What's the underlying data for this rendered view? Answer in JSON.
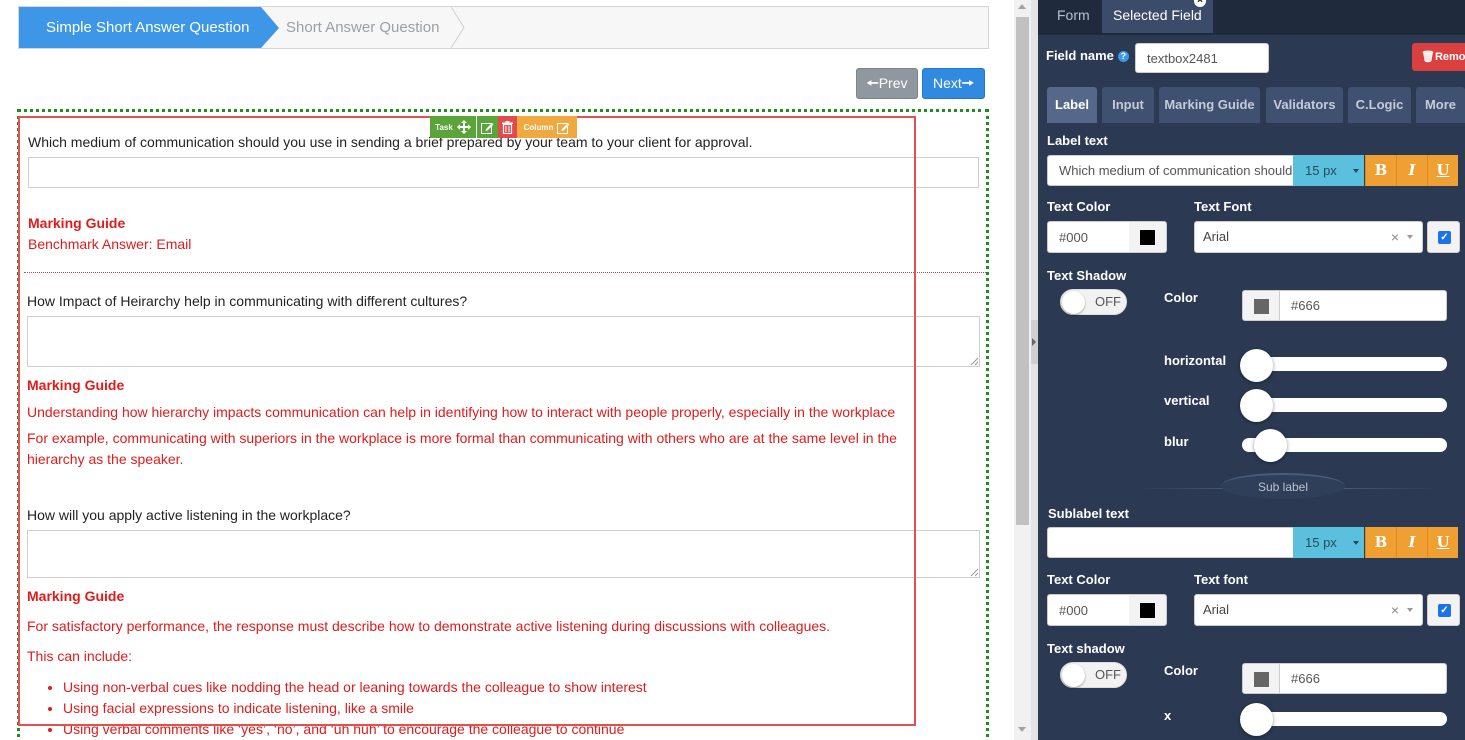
{
  "wizard": {
    "step1": "Simple Short Answer Question",
    "step2": "Short Answer Question"
  },
  "nav": {
    "prev": "Prev",
    "next": "Next"
  },
  "toolbar": {
    "task": "Task",
    "column": "Column"
  },
  "questions": [
    {
      "text": "Which medium of communication should you use in sending a brief prepared by your team to your client for approval.",
      "marking_title": "Marking Guide",
      "marking_lines": [
        "Benchmark Answer: Email"
      ]
    },
    {
      "text": "How Impact of Heirarchy help in communicating with different cultures?",
      "marking_title": "Marking Guide",
      "marking_lines": [
        "Understanding how hierarchy impacts communication can help in identifying how to interact with people properly, especially in the workplace",
        "For example, communicating with superiors in the workplace is more formal than communicating with others who are at the same level in the hierarchy as the speaker."
      ]
    },
    {
      "text": "How will you apply active listening in the workplace?",
      "marking_title": "Marking Guide",
      "marking_lines": [
        "For satisfactory performance, the response must describe how to demonstrate active listening during discussions with colleagues.",
        "This can include:"
      ],
      "bullets": [
        "Using non-verbal cues like nodding the head or leaning towards the colleague to show interest",
        "Using facial expressions to indicate listening, like a smile",
        "Using verbal comments like ‘yes’, ‘no’, and ‘uh huh’ to encourage the colleague to continue"
      ]
    }
  ],
  "panel": {
    "tabs": [
      "Form",
      "Selected Field"
    ],
    "field_name_label": "Field name",
    "field_name_value": "textbox2481",
    "remove_label": "Remove",
    "subtabs": [
      "Label",
      "Input",
      "Marking Guide",
      "Validators",
      "C.Logic",
      "More"
    ],
    "label_text_label": "Label text",
    "label_text_value": "Which medium of communication should you use in sending a brief prepared by your team to your client for approval.",
    "size": "15 px",
    "fmt": [
      "B",
      "I",
      "U"
    ],
    "text_color_label": "Text Color",
    "text_color_value": "#000",
    "text_font_label": "Text Font",
    "text_font_value": "Arial",
    "text_shadow_label": "Text Shadow",
    "toggle_off": "OFF",
    "color_label": "Color",
    "shadow_color_value": "#666",
    "horizontal_label": "horizontal",
    "vertical_label": "vertical",
    "blur_label": "blur",
    "sublabel_tab": "Sub label",
    "sublabel_text_label": "Sublabel text",
    "sublabel_text_value": "",
    "sub_size": "15 px",
    "sub_text_color_label": "Text Color",
    "sub_text_color_value": "#000",
    "sub_text_font_label": "Text font",
    "sub_text_font_value": "Arial",
    "sub_text_shadow_label": "Text shadow",
    "sub_color_label": "Color",
    "sub_shadow_color_value": "#666",
    "x_label": "x"
  },
  "colors": {
    "accent": "#3d97e6",
    "panel_bg": "#2b3a52",
    "marking": "#e01b1b",
    "format_buttons": "#f0a033",
    "size_button": "#5bc0de"
  }
}
